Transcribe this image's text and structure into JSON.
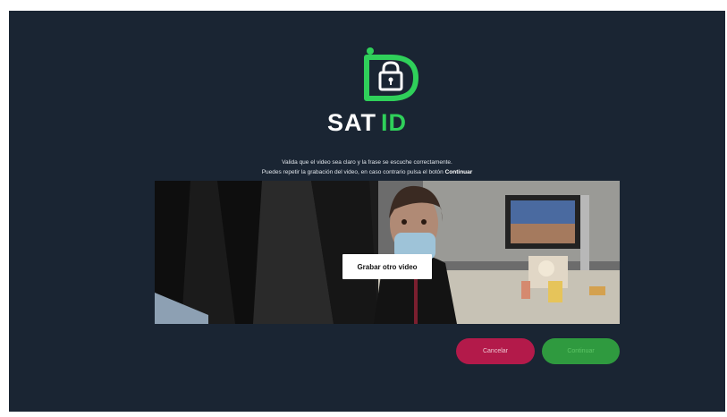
{
  "brand": {
    "name_white": "SAT",
    "name_green": "ID",
    "primary_color": "#2fd05a",
    "background_color": "#1a2533",
    "logo_icon": "lock-icon"
  },
  "instructions": {
    "line1": "Valida que el video sea claro y la frase se escuche correctamente.",
    "line2_prefix": "Puedes repetir la grabación del video, en caso contrario pulsa el botón",
    "line2_bold": "Continuar"
  },
  "video": {
    "record_again_label": "Grabar otro video"
  },
  "actions": {
    "cancel_label": "Cancelar",
    "continue_label": "Continuar",
    "cancel_color": "#b31a4a",
    "continue_color": "#2f9a3f"
  }
}
